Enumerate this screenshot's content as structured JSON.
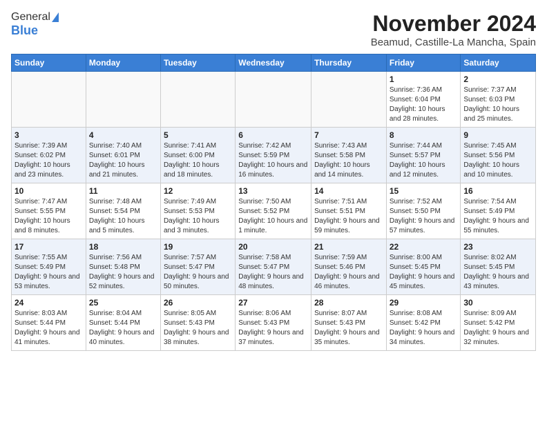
{
  "logo": {
    "general": "General",
    "blue": "Blue"
  },
  "title": "November 2024",
  "location": "Beamud, Castille-La Mancha, Spain",
  "days_of_week": [
    "Sunday",
    "Monday",
    "Tuesday",
    "Wednesday",
    "Thursday",
    "Friday",
    "Saturday"
  ],
  "weeks": [
    [
      {
        "day": null,
        "info": null
      },
      {
        "day": null,
        "info": null
      },
      {
        "day": null,
        "info": null
      },
      {
        "day": null,
        "info": null
      },
      {
        "day": null,
        "info": null
      },
      {
        "day": "1",
        "info": "Sunrise: 7:36 AM\nSunset: 6:04 PM\nDaylight: 10 hours and 28 minutes."
      },
      {
        "day": "2",
        "info": "Sunrise: 7:37 AM\nSunset: 6:03 PM\nDaylight: 10 hours and 25 minutes."
      }
    ],
    [
      {
        "day": "3",
        "info": "Sunrise: 7:39 AM\nSunset: 6:02 PM\nDaylight: 10 hours and 23 minutes."
      },
      {
        "day": "4",
        "info": "Sunrise: 7:40 AM\nSunset: 6:01 PM\nDaylight: 10 hours and 21 minutes."
      },
      {
        "day": "5",
        "info": "Sunrise: 7:41 AM\nSunset: 6:00 PM\nDaylight: 10 hours and 18 minutes."
      },
      {
        "day": "6",
        "info": "Sunrise: 7:42 AM\nSunset: 5:59 PM\nDaylight: 10 hours and 16 minutes."
      },
      {
        "day": "7",
        "info": "Sunrise: 7:43 AM\nSunset: 5:58 PM\nDaylight: 10 hours and 14 minutes."
      },
      {
        "day": "8",
        "info": "Sunrise: 7:44 AM\nSunset: 5:57 PM\nDaylight: 10 hours and 12 minutes."
      },
      {
        "day": "9",
        "info": "Sunrise: 7:45 AM\nSunset: 5:56 PM\nDaylight: 10 hours and 10 minutes."
      }
    ],
    [
      {
        "day": "10",
        "info": "Sunrise: 7:47 AM\nSunset: 5:55 PM\nDaylight: 10 hours and 8 minutes."
      },
      {
        "day": "11",
        "info": "Sunrise: 7:48 AM\nSunset: 5:54 PM\nDaylight: 10 hours and 5 minutes."
      },
      {
        "day": "12",
        "info": "Sunrise: 7:49 AM\nSunset: 5:53 PM\nDaylight: 10 hours and 3 minutes."
      },
      {
        "day": "13",
        "info": "Sunrise: 7:50 AM\nSunset: 5:52 PM\nDaylight: 10 hours and 1 minute."
      },
      {
        "day": "14",
        "info": "Sunrise: 7:51 AM\nSunset: 5:51 PM\nDaylight: 9 hours and 59 minutes."
      },
      {
        "day": "15",
        "info": "Sunrise: 7:52 AM\nSunset: 5:50 PM\nDaylight: 9 hours and 57 minutes."
      },
      {
        "day": "16",
        "info": "Sunrise: 7:54 AM\nSunset: 5:49 PM\nDaylight: 9 hours and 55 minutes."
      }
    ],
    [
      {
        "day": "17",
        "info": "Sunrise: 7:55 AM\nSunset: 5:49 PM\nDaylight: 9 hours and 53 minutes."
      },
      {
        "day": "18",
        "info": "Sunrise: 7:56 AM\nSunset: 5:48 PM\nDaylight: 9 hours and 52 minutes."
      },
      {
        "day": "19",
        "info": "Sunrise: 7:57 AM\nSunset: 5:47 PM\nDaylight: 9 hours and 50 minutes."
      },
      {
        "day": "20",
        "info": "Sunrise: 7:58 AM\nSunset: 5:47 PM\nDaylight: 9 hours and 48 minutes."
      },
      {
        "day": "21",
        "info": "Sunrise: 7:59 AM\nSunset: 5:46 PM\nDaylight: 9 hours and 46 minutes."
      },
      {
        "day": "22",
        "info": "Sunrise: 8:00 AM\nSunset: 5:45 PM\nDaylight: 9 hours and 45 minutes."
      },
      {
        "day": "23",
        "info": "Sunrise: 8:02 AM\nSunset: 5:45 PM\nDaylight: 9 hours and 43 minutes."
      }
    ],
    [
      {
        "day": "24",
        "info": "Sunrise: 8:03 AM\nSunset: 5:44 PM\nDaylight: 9 hours and 41 minutes."
      },
      {
        "day": "25",
        "info": "Sunrise: 8:04 AM\nSunset: 5:44 PM\nDaylight: 9 hours and 40 minutes."
      },
      {
        "day": "26",
        "info": "Sunrise: 8:05 AM\nSunset: 5:43 PM\nDaylight: 9 hours and 38 minutes."
      },
      {
        "day": "27",
        "info": "Sunrise: 8:06 AM\nSunset: 5:43 PM\nDaylight: 9 hours and 37 minutes."
      },
      {
        "day": "28",
        "info": "Sunrise: 8:07 AM\nSunset: 5:43 PM\nDaylight: 9 hours and 35 minutes."
      },
      {
        "day": "29",
        "info": "Sunrise: 8:08 AM\nSunset: 5:42 PM\nDaylight: 9 hours and 34 minutes."
      },
      {
        "day": "30",
        "info": "Sunrise: 8:09 AM\nSunset: 5:42 PM\nDaylight: 9 hours and 32 minutes."
      }
    ]
  ]
}
